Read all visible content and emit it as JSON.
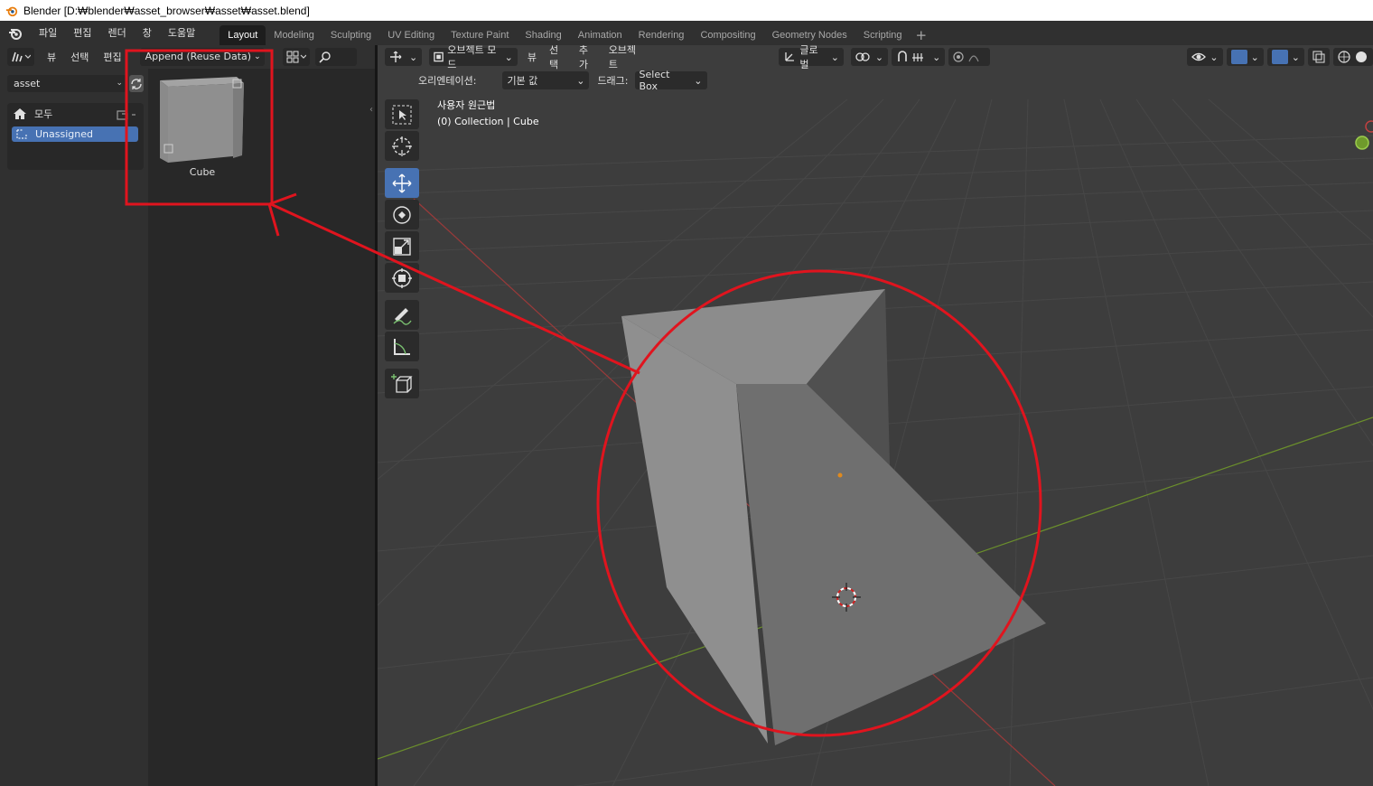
{
  "window": {
    "title": "Blender [D:₩blender₩asset_browser₩asset₩asset.blend]"
  },
  "menu": {
    "items": [
      "파일",
      "편집",
      "렌더",
      "창",
      "도움말"
    ]
  },
  "workspaces": {
    "tabs": [
      "Layout",
      "Modeling",
      "Sculpting",
      "UV Editing",
      "Texture Paint",
      "Shading",
      "Animation",
      "Rendering",
      "Compositing",
      "Geometry Nodes",
      "Scripting"
    ],
    "active": "Layout"
  },
  "asset_browser": {
    "header": {
      "view": "뷰",
      "select": "선택",
      "edit": "편집",
      "import_mode": "Append (Reuse Data)"
    },
    "library": "asset",
    "categories": {
      "all": "모두",
      "unassigned": "Unassigned"
    },
    "assets": [
      {
        "name": "Cube"
      }
    ]
  },
  "viewport": {
    "header": {
      "mode": "오브젝트 모드",
      "view": "뷰",
      "select": "선택",
      "add": "추가",
      "object": "오브젝트",
      "transform_orientation": "글로벌"
    },
    "tool_settings": {
      "orientation_label": "오리엔테이션:",
      "orientation_value": "기본 값",
      "drag_label": "드래그:",
      "drag_value": "Select Box"
    },
    "info": {
      "projection": "사용자 원근법",
      "collection": "(0) Collection | Cube"
    }
  },
  "colors": {
    "accent": "#4772b3",
    "annotation_red": "#e0141e",
    "x_axis": "#9b3a3a",
    "y_axis": "#6b8f2c"
  }
}
